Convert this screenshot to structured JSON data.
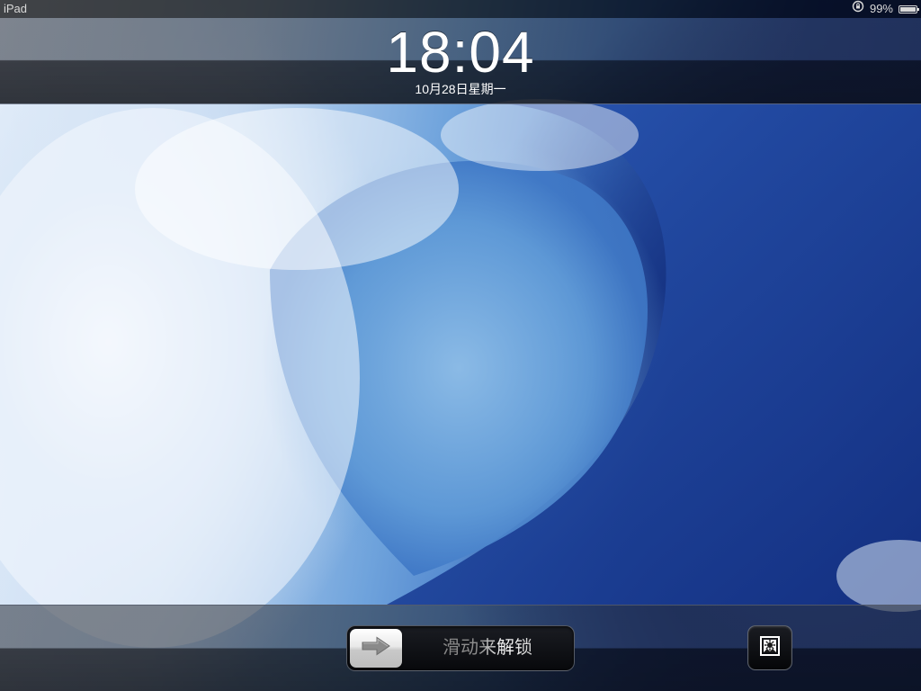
{
  "status_bar": {
    "device_name": "iPad",
    "battery_percent": "99%",
    "battery_level": 0.99,
    "icons": [
      "rotation-lock-icon",
      "battery-icon"
    ]
  },
  "lock_screen": {
    "time": "18:04",
    "date": "10月28日星期一"
  },
  "unlock_slider": {
    "label": "滑动来解锁",
    "knob_icon": "arrow-right-icon"
  },
  "photo_frame_button": {
    "icon": "photo-frame-icon"
  },
  "wallpaper": {
    "subject": "ocean wave",
    "colors": [
      "#e9f1fb",
      "#6fa3dc",
      "#1d3f97"
    ]
  }
}
